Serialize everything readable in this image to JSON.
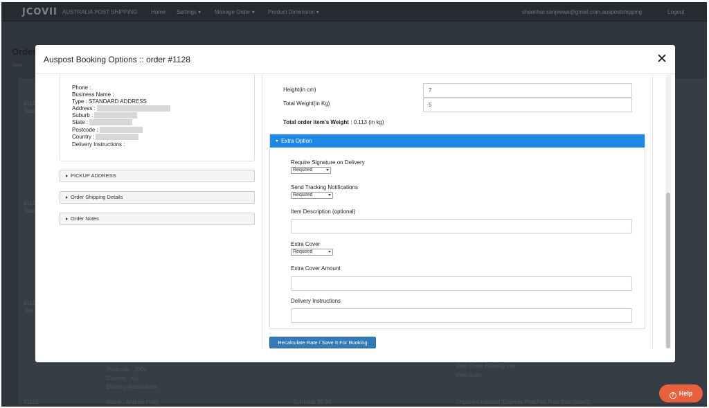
{
  "app": {
    "logo": "JCOVII",
    "brand": "AUSTRALIA POST SHIPPING",
    "nav": [
      "Home",
      "Settings ▾",
      "Manage Order ▾",
      "Product Dimension ▾"
    ],
    "user": "shaekhar.sanjeewa@gmail.com.auspostshipping",
    "logout": "Logout"
  },
  "background": {
    "title": "Orders",
    "subtitle": "Show",
    "rows": [
      {
        "id": "#112",
        "note": "Toda"
      },
      {
        "id": "#112",
        "note": "Toda"
      },
      {
        "id": "#112",
        "note": "Yest"
      }
    ],
    "address_tail": [
      "Postcode : 2000",
      "Country : AU",
      "Delivery Instructions :"
    ],
    "right_tail": [
      "View Order Booking Info",
      "View order"
    ],
    "last_row": {
      "id": "#1125",
      "name": "Name : Andrew Petty",
      "subtotal": "SubTotal: $5.80",
      "status": "Shipment Initiated [Express Post Flat Rate Box(Small)]"
    }
  },
  "modal": {
    "title": "Auspost Booking Options :: order #1128",
    "address": {
      "phone": "Phone :",
      "business": "Business Name :",
      "type": "Type : STANDARD ADDRESS",
      "address": "Address :",
      "suburb": "Suburb :",
      "state": "State :",
      "postcode": "Postcode :",
      "country": "Country :",
      "instructions": "Delivery Instructions :"
    },
    "panels": {
      "pickup": "PICKUP ADDRESS",
      "shipping": "Order Shipping Details",
      "notes": "Order Notes"
    },
    "height_label": "Height(in cm)",
    "height_value": "7",
    "weight_label": "Total Weight(in Kg)",
    "weight_value": "5",
    "total_weight_label": "Total order item's Weight",
    "total_weight_value": ": 0.113 (in kg)",
    "extra": {
      "header": "Extra Option",
      "signature_label": "Require Signature on Delivery",
      "signature_value": "Required",
      "tracking_label": "Send Tracking Notifications",
      "tracking_value": "Required",
      "description_label": "Item Description (optional)",
      "description_value": "",
      "cover_label": "Extra Cover",
      "cover_value": "Required",
      "cover_amount_label": "Extra Cover Amount",
      "cover_amount_value": "",
      "delivery_label": "Delivery Instructions",
      "delivery_value": ""
    },
    "submit": "Recalculate Rate / Save It For Booking"
  },
  "help": "Help"
}
